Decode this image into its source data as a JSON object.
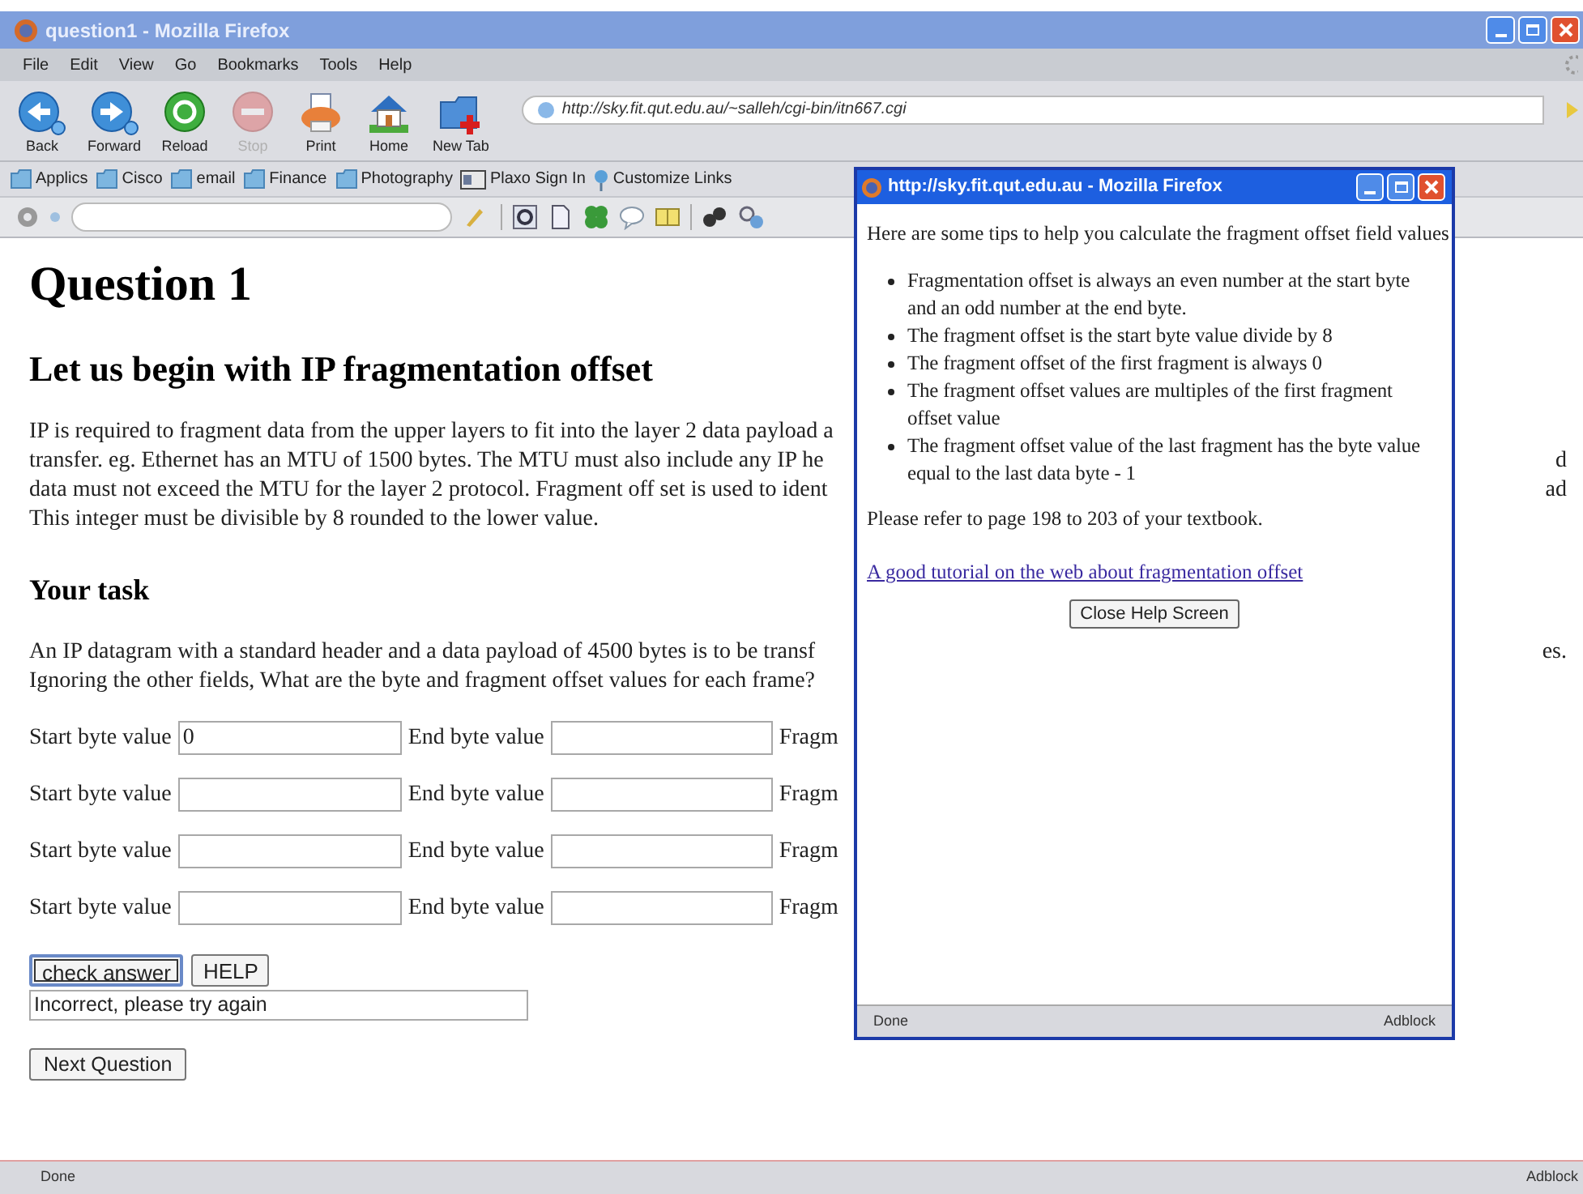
{
  "window": {
    "title": "question1 - Mozilla Firefox"
  },
  "menu": [
    "File",
    "Edit",
    "View",
    "Go",
    "Bookmarks",
    "Tools",
    "Help"
  ],
  "nav_buttons": [
    {
      "label": "Back",
      "kind": "back",
      "disabled": false
    },
    {
      "label": "Forward",
      "kind": "forward",
      "disabled": false
    },
    {
      "label": "Reload",
      "kind": "reload",
      "disabled": false
    },
    {
      "label": "Stop",
      "kind": "stop",
      "disabled": true
    },
    {
      "label": "Print",
      "kind": "print",
      "disabled": false
    },
    {
      "label": "Home",
      "kind": "home",
      "disabled": false
    },
    {
      "label": "New Tab",
      "kind": "newtab",
      "disabled": false
    }
  ],
  "address": "http://sky.fit.qut.edu.au/~salleh/cgi-bin/itn667.cgi",
  "bookmarks": [
    {
      "label": "Applics",
      "kind": "feed"
    },
    {
      "label": "Cisco",
      "kind": "feed"
    },
    {
      "label": "email",
      "kind": "feed"
    },
    {
      "label": "Finance",
      "kind": "feed"
    },
    {
      "label": "Photography",
      "kind": "feed"
    },
    {
      "label": "Plaxo Sign In",
      "kind": "card"
    },
    {
      "label": "Customize Links",
      "kind": "pin"
    }
  ],
  "page": {
    "heading": "Question 1",
    "subheading": "Let us begin with IP fragmentation offset",
    "intro_lines": [
      {
        "left": "IP is required to fragment data from the upper layers to fit into the layer 2 data payload a"
      },
      {
        "left": "transfer. eg. Ethernet has an MTU of 1500 bytes. The MTU must also include any IP he",
        "right": "d"
      },
      {
        "left": "data must not exceed the MTU for the layer 2 protocol. Fragment off set is used to ident",
        "right": "ad"
      },
      {
        "left": "This integer must be divisible by 8 rounded to the lower value."
      }
    ],
    "task_heading": "Your task",
    "task_lines": [
      {
        "left": "An IP datagram with a standard header and a data payload of 4500 bytes is to be transf",
        "right": "es."
      },
      {
        "left": "Ignoring the other fields, What are the byte and fragment offset values for each frame?"
      }
    ],
    "rows": [
      {
        "start_label": "Start byte value",
        "start_value": "0",
        "end_label": "End byte value",
        "offset_label": "Fragm"
      },
      {
        "start_label": "Start byte value",
        "end_label": "End byte value",
        "offset_label": "Fragm"
      },
      {
        "start_label": "Start byte value",
        "end_label": "End byte value",
        "offset_label": "Fragm"
      },
      {
        "start_label": "Start byte value",
        "end_label": "End byte value",
        "offset_label": "Fragm"
      }
    ],
    "buttons": [
      {
        "label": "check answer",
        "focused": true
      },
      {
        "label": "HELP",
        "focused": false
      }
    ],
    "result": "Incorrect, please try again",
    "next_button": "Next Question"
  },
  "status_bar": {
    "left": "Done",
    "right": "Adblock"
  },
  "popup": {
    "title": "http://sky.fit.qut.edu.au - Mozilla Firefox",
    "intro": "Here are some tips to help you calculate the fragment offset field values",
    "tips": [
      "Fragmentation offset is always an even number at the start byte and an odd number at the end byte.",
      "The fragment offset is the start byte value divide by 8",
      "The fragment offset of the first fragment is always 0",
      "The fragment offset values are multiples of the first fragment offset value",
      "The fragment offset value of the last fragment has the byte value equal to the last data byte - 1"
    ],
    "reference": "Please refer to page 198 to 203 of your textbook.",
    "link": "A good tutorial on the web about fragmentation offset",
    "button": "Close Help Screen",
    "status_bar": {
      "left": "Done",
      "right": "Adblock"
    }
  }
}
